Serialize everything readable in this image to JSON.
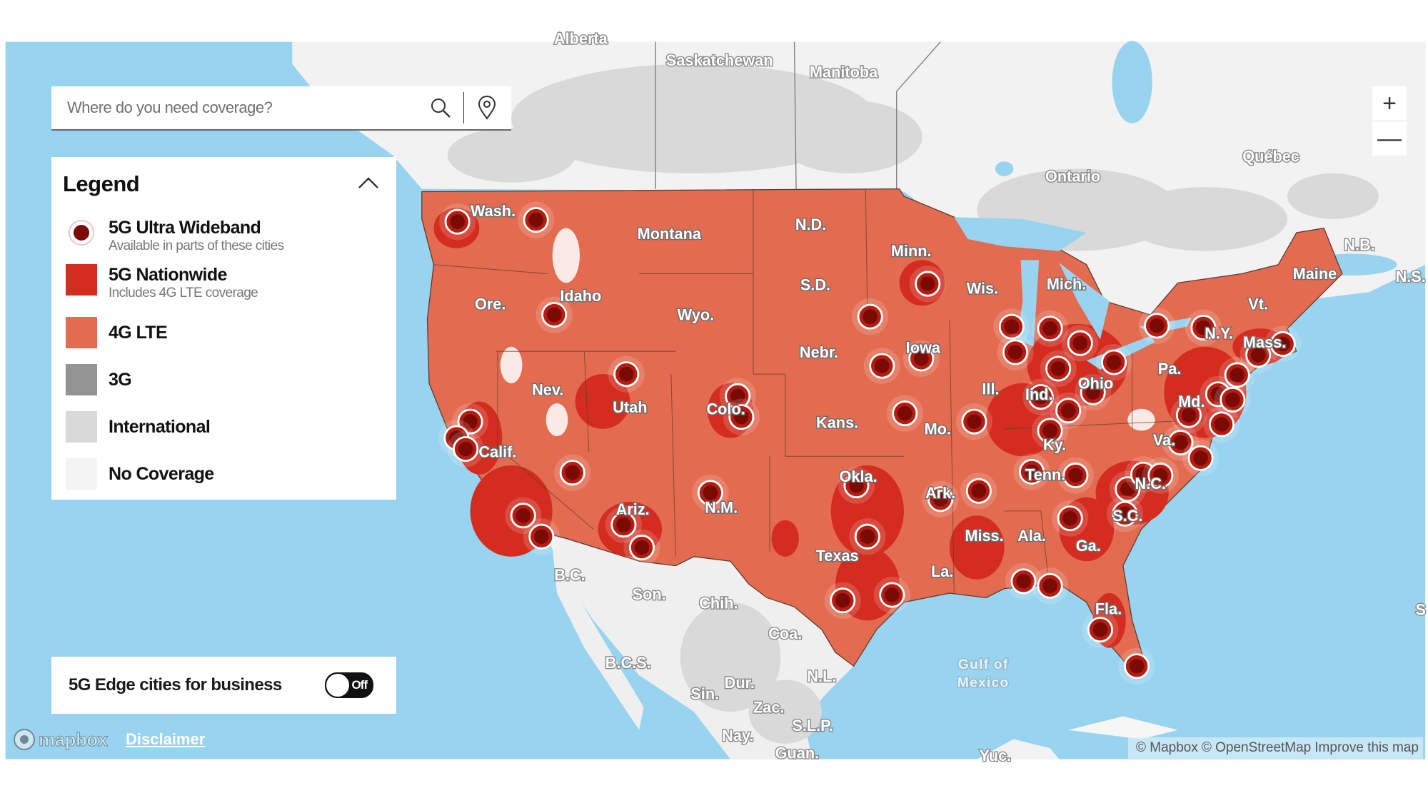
{
  "colors": {
    "ocean": "#98d3ef",
    "lte": "#e36b50",
    "nationwide_5g": "#d42d1f",
    "uwb_dot": "#7a0a04",
    "three_g": "#939393",
    "international": "#d9d9d9",
    "no_coverage": "#f4f4f4"
  },
  "search": {
    "placeholder": "Where do you need coverage?",
    "value": "",
    "search_icon": "search-icon",
    "locate_icon": "location-pin-icon"
  },
  "legend": {
    "title": "Legend",
    "collapse_icon": "chevron-up-icon",
    "items": [
      {
        "title": "5G Ultra Wideband",
        "subtitle": "Available in parts of these cities",
        "swatch": "dot"
      },
      {
        "title": "5G Nationwide",
        "subtitle": "Includes 4G LTE coverage",
        "swatch": "#d42d1f"
      },
      {
        "title": "4G LTE",
        "subtitle": "",
        "swatch": "#e36b50"
      },
      {
        "title": "3G",
        "subtitle": "",
        "swatch": "#939393"
      },
      {
        "title": "International",
        "subtitle": "",
        "swatch": "#d9d9d9"
      },
      {
        "title": "No Coverage",
        "subtitle": "",
        "swatch": "#f4f4f4"
      }
    ]
  },
  "edge_toggle": {
    "label": "5G Edge cities for business",
    "state": "Off"
  },
  "zoom": {
    "in": "+",
    "out": "—"
  },
  "footer": {
    "mapbox": "mapbox",
    "disclaimer": "Disclaimer",
    "attribution": [
      "© Mapbox",
      "© OpenStreetMap",
      "Improve this map"
    ]
  },
  "map_labels": {
    "us_states": [
      "Wash.",
      "Montana",
      "N.D.",
      "Minn.",
      "Ore.",
      "Idaho",
      "Wyo.",
      "S.D.",
      "Wis.",
      "Mich.",
      "Nebr.",
      "Iowa",
      "Nev.",
      "Utah",
      "Colo.",
      "Kans.",
      "Mo.",
      "Ill.",
      "Ind.",
      "Ohio",
      "Pa.",
      "N.Y.",
      "Vt.",
      "Maine",
      "Mass.",
      "Md.",
      "Va.",
      "Ky.",
      "Tenn.",
      "N.C.",
      "S.C.",
      "Calif.",
      "Ariz.",
      "N.M.",
      "Okla.",
      "Ark.",
      "Texas",
      "Miss.",
      "Ala.",
      "Ga.",
      "La.",
      "Fla."
    ],
    "canada": [
      "Alberta",
      "Saskatchewan",
      "Manitoba",
      "Ontario",
      "Québec",
      "N.B.",
      "N.S."
    ],
    "mexico": [
      "B.C.",
      "Son.",
      "Chih.",
      "Coa.",
      "B.C.S.",
      "Dur.",
      "N.L.",
      "Sin.",
      "Zac.",
      "S.L.P.",
      "Nay.",
      "Guan.",
      "Yuc."
    ],
    "water": [
      "Gulf of",
      "Mexico"
    ],
    "edge": [
      "S"
    ]
  }
}
